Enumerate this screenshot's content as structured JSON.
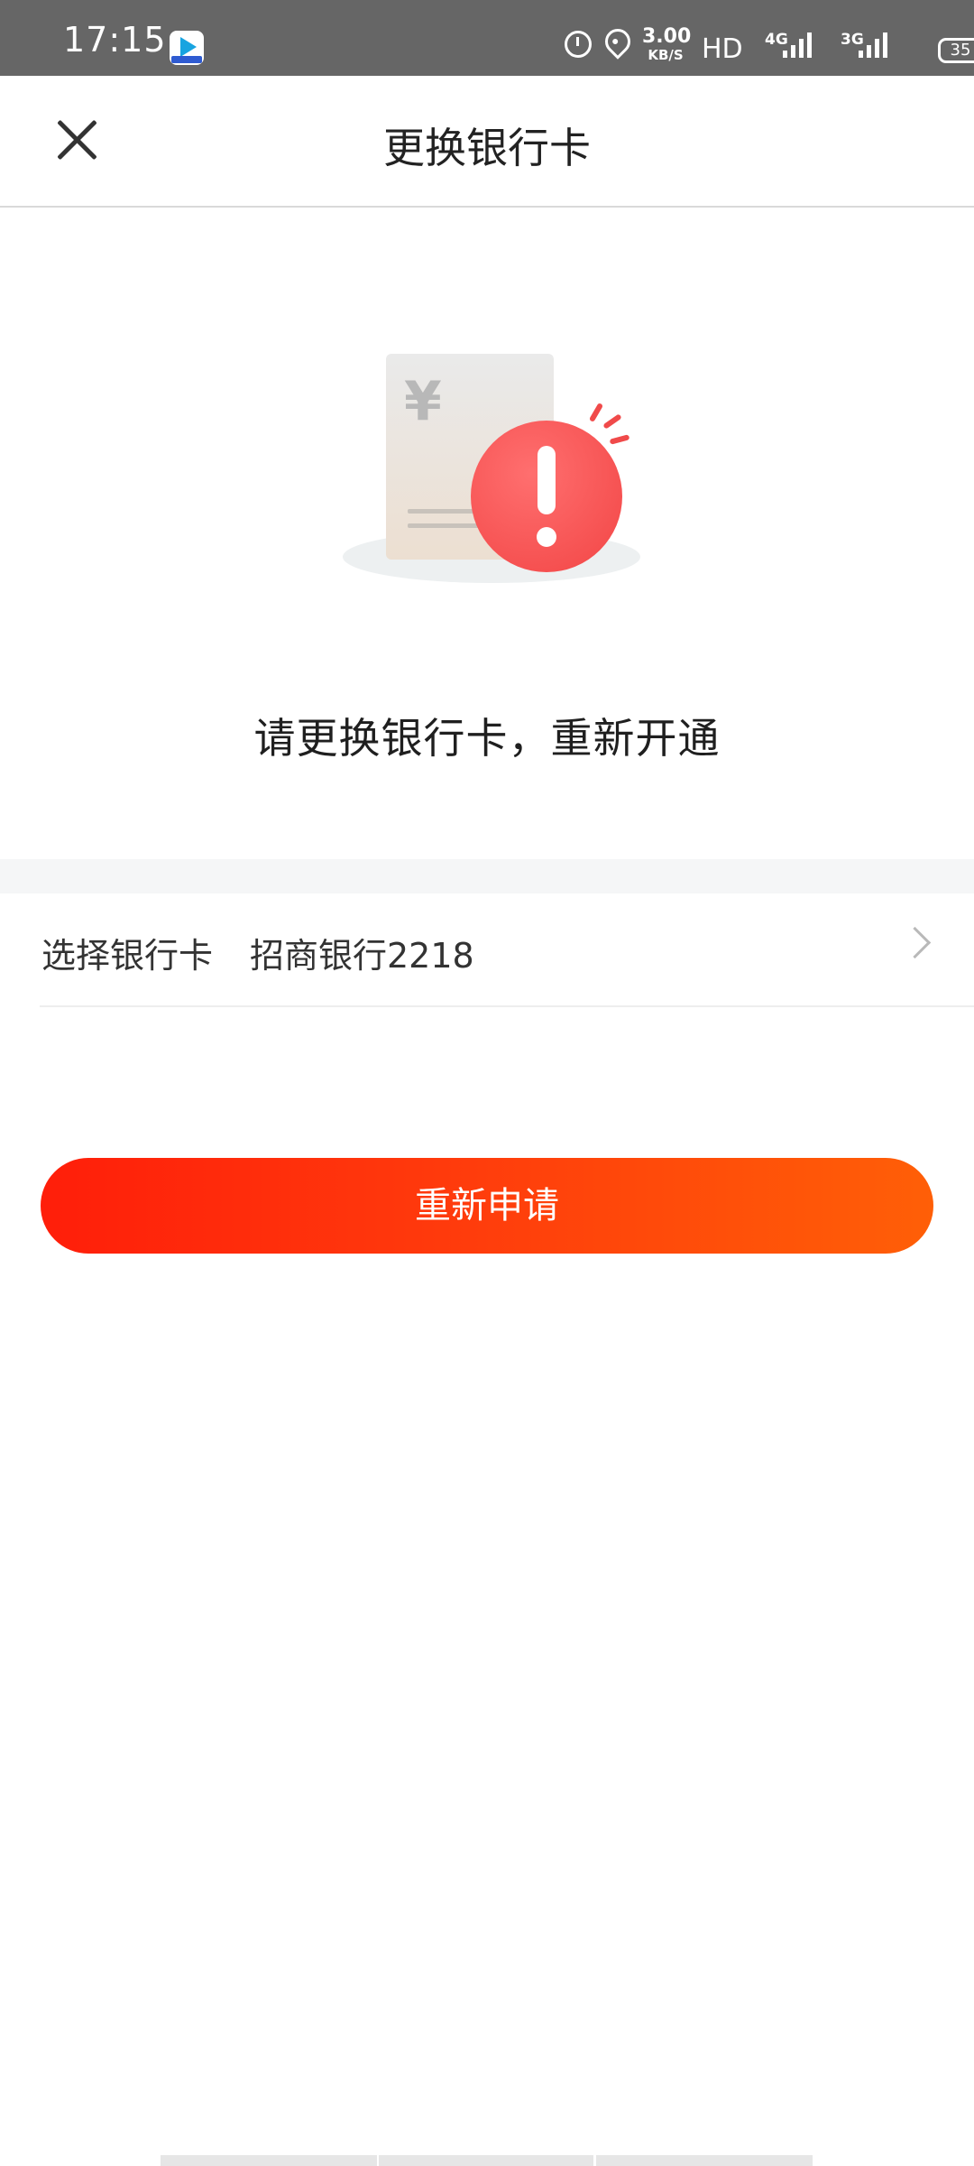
{
  "status_bar": {
    "time": "17:15",
    "app_icon": "video-app-icon",
    "speed_value": "3.00",
    "speed_unit": "KB/S",
    "hd_label": "HD",
    "network_1": "4G",
    "network_2": "3G",
    "battery": "35"
  },
  "header": {
    "close_icon": "close-icon",
    "title": "更换银行卡"
  },
  "illustration": {
    "currency_symbol": "¥",
    "alert_icon": "exclamation-alert-icon",
    "alert_color": "#f24545"
  },
  "message": "请更换银行卡，重新开通",
  "bank_selector": {
    "label": "选择银行卡",
    "value": "招商银行2218",
    "chevron_icon": "chevron-right-icon"
  },
  "primary_action": {
    "label": "重新申请",
    "color_start": "#ff1e0a",
    "color_end": "#ff5f07"
  }
}
